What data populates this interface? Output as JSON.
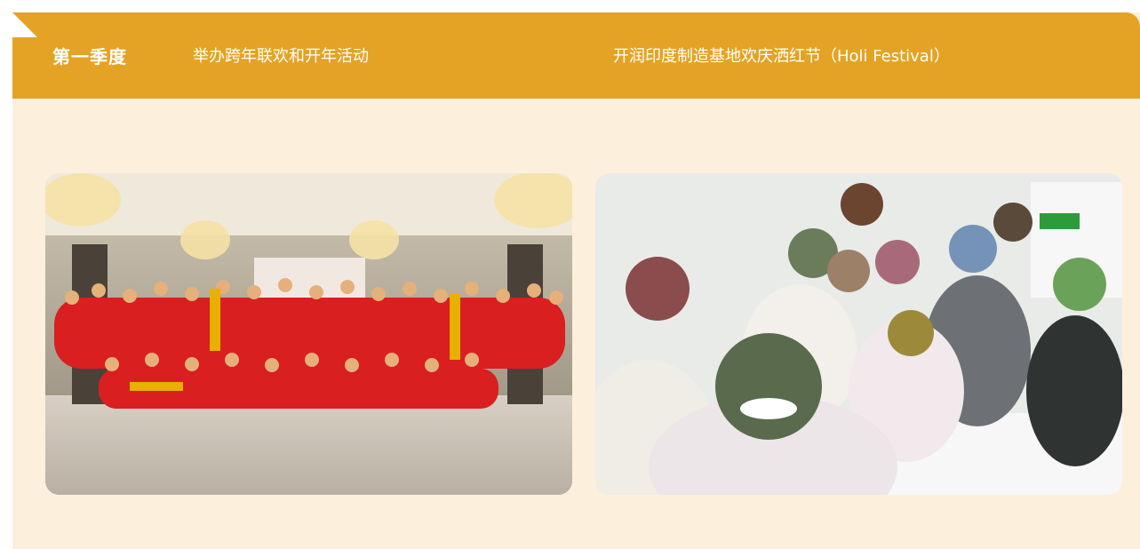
{
  "colors": {
    "header_bg": "#e4a324",
    "card_bg": "#fcefdc",
    "text": "#ffffff"
  },
  "header": {
    "quarter_label": "第一季度",
    "caption_left": "举办跨年联欢和开年活动",
    "caption_right": "开润印度制造基地欢庆洒红节（Holi Festival）"
  },
  "photos": [
    {
      "name": "new-year-party-group-photo"
    },
    {
      "name": "holi-festival-selfie-photo"
    }
  ]
}
